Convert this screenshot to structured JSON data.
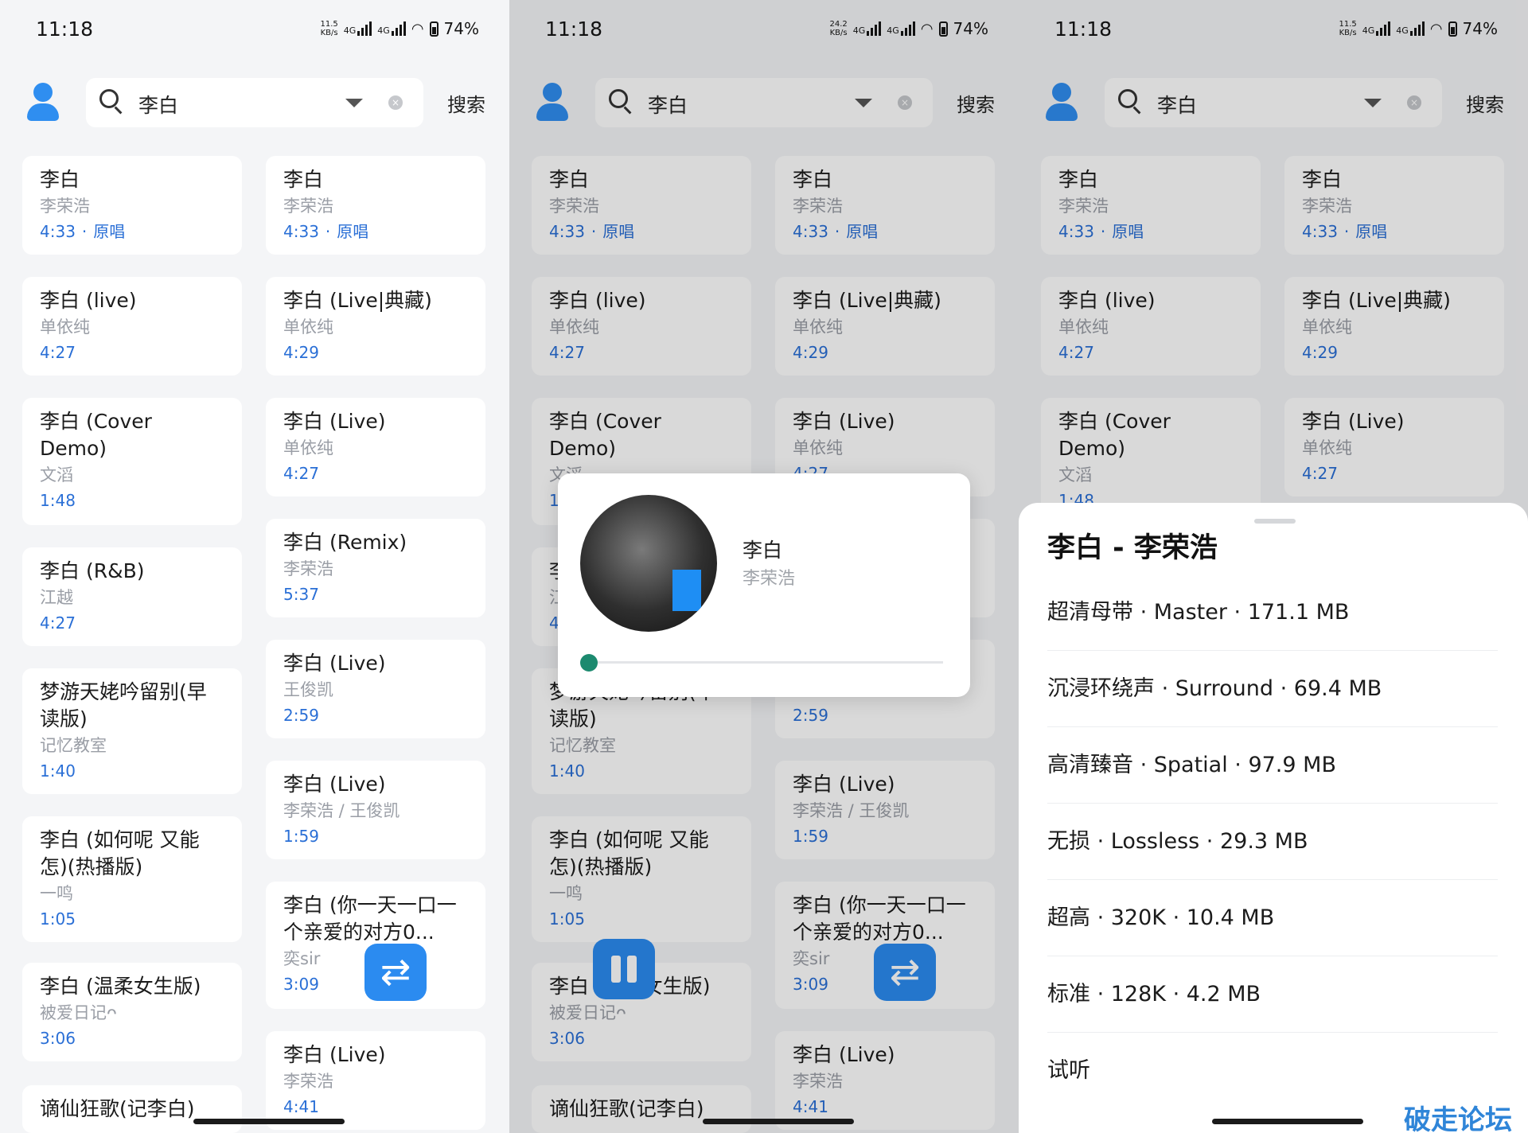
{
  "status": {
    "time": "11:18",
    "speed_a": "11.5",
    "speed_b": "24.2",
    "speed_unit": "KB/s",
    "net": "4G",
    "battery": "74%"
  },
  "search": {
    "query": "李白",
    "button": "搜索"
  },
  "songs_left": [
    {
      "title": "李白",
      "artist": "李荣浩",
      "duration": "4:33",
      "tag": "原唱"
    },
    {
      "title": "李白 (live)",
      "artist": "单依纯",
      "duration": "4:27",
      "tag": ""
    },
    {
      "title": "李白 (Cover Demo)",
      "artist": "文滔",
      "duration": "1:48",
      "tag": ""
    },
    {
      "title": "李白 (R&B)",
      "artist": "江越",
      "duration": "4:27",
      "tag": ""
    },
    {
      "title": "梦游天姥吟留别(早读版)",
      "artist": "记忆教室",
      "duration": "1:40",
      "tag": ""
    },
    {
      "title": "李白 (如何呢 又能怎)(热播版)",
      "artist": "一鸣",
      "duration": "1:05",
      "tag": ""
    },
    {
      "title": "李白 (温柔女生版)",
      "artist": "被爱日记ᴖ",
      "duration": "3:06",
      "tag": ""
    },
    {
      "title": "谪仙狂歌(记李白)",
      "artist": "",
      "duration": "",
      "tag": ""
    }
  ],
  "songs_right": [
    {
      "title": "李白",
      "artist": "李荣浩",
      "duration": "4:33",
      "tag": "原唱"
    },
    {
      "title": "李白 (Live|典藏)",
      "artist": "单依纯",
      "duration": "4:29",
      "tag": ""
    },
    {
      "title": "李白 (Live)",
      "artist": "单依纯",
      "duration": "4:27",
      "tag": ""
    },
    {
      "title": "李白 (Remix)",
      "artist": "李荣浩",
      "duration": "5:37",
      "tag": ""
    },
    {
      "title": "李白 (Live)",
      "artist": "王俊凯",
      "duration": "2:59",
      "tag": ""
    },
    {
      "title": "李白 (Live)",
      "artist": "李荣浩 / 王俊凯",
      "duration": "1:59",
      "tag": ""
    },
    {
      "title": "李白 (你一天一口一个亲爱的对方0...",
      "artist": "奕sir",
      "duration": "3:09",
      "tag": ""
    },
    {
      "title": "李白 (Live)",
      "artist": "李荣浩",
      "duration": "4:41",
      "tag": ""
    }
  ],
  "meta_sep": "·",
  "player": {
    "title": "李白",
    "artist": "李荣浩",
    "progress": 0.0
  },
  "sheet": {
    "title": "李白 - 李荣浩",
    "options": [
      "超清母带 · Master · 171.1 MB",
      "沉浸环绕声 · Surround · 69.4 MB",
      "高清臻音 · Spatial · 97.9 MB",
      "无损 · Lossless · 29.3 MB",
      "超高 · 320K · 10.4 MB",
      "标准 · 128K · 4.2 MB",
      "试听"
    ]
  },
  "icons": {
    "swap": "swap-icon",
    "pause": "pause-icon",
    "user": "user-icon",
    "search": "search-icon"
  },
  "colors": {
    "accent": "#2b8bf0",
    "link": "#2a6fd6",
    "progress": "#1c8a6f"
  },
  "watermark": "破走论坛"
}
